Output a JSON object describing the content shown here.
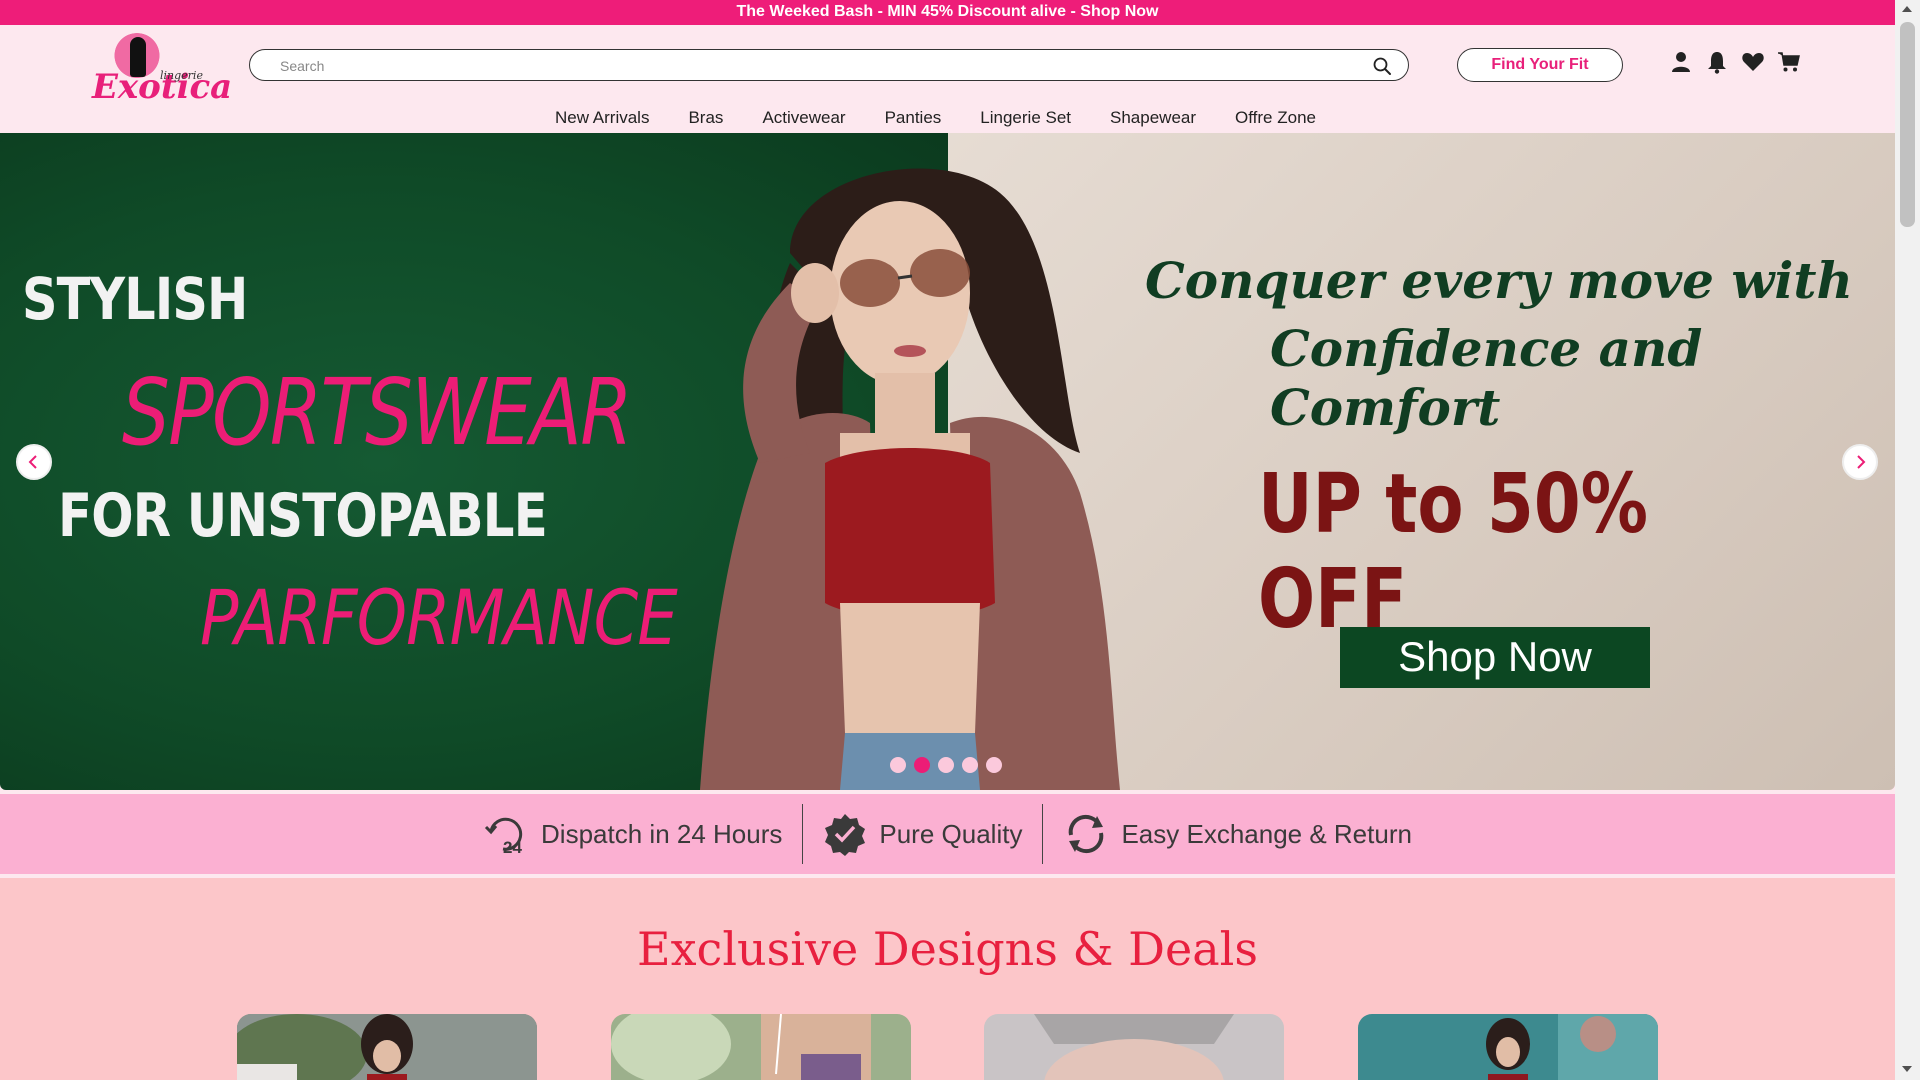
{
  "promo": {
    "text": "The Weeked Bash - MIN 45% Discount alive - Shop Now"
  },
  "logo": {
    "main": "Exotica",
    "sub": "lingerie"
  },
  "search": {
    "placeholder": "Search"
  },
  "header": {
    "fit_button": "Find Your Fit"
  },
  "nav": {
    "items": [
      "New Arrivals",
      "Bras",
      "Activewear",
      "Panties",
      "Lingerie Set",
      "Shapewear",
      "Offre Zone"
    ]
  },
  "hero": {
    "line1": "STYLISH",
    "line2": "SPORTSWEAR",
    "line3": "FOR UNSTOPABLE",
    "line4": "PARFORMANCE",
    "tagline1": "Conquer every move with",
    "tagline2": "Confidence and Comfort",
    "offer": "UP to 50% OFF",
    "cta": "Shop Now",
    "active_slide": 2,
    "slide_count": 5
  },
  "features": {
    "items": [
      {
        "label": "Dispatch in 24 Hours",
        "icon": "dispatch-24-icon"
      },
      {
        "label": "Pure Quality",
        "icon": "check-badge-icon"
      },
      {
        "label": "Easy Exchange & Return",
        "icon": "exchange-icon"
      }
    ]
  },
  "deals": {
    "title": "Exclusive Designs & Deals"
  },
  "colors": {
    "brand_pink": "#ee1d79",
    "hero_green": "#0f4a27",
    "feature_bg": "#fbb0d2",
    "deals_bg": "#fcc6c9",
    "deals_title": "#e8203f"
  }
}
